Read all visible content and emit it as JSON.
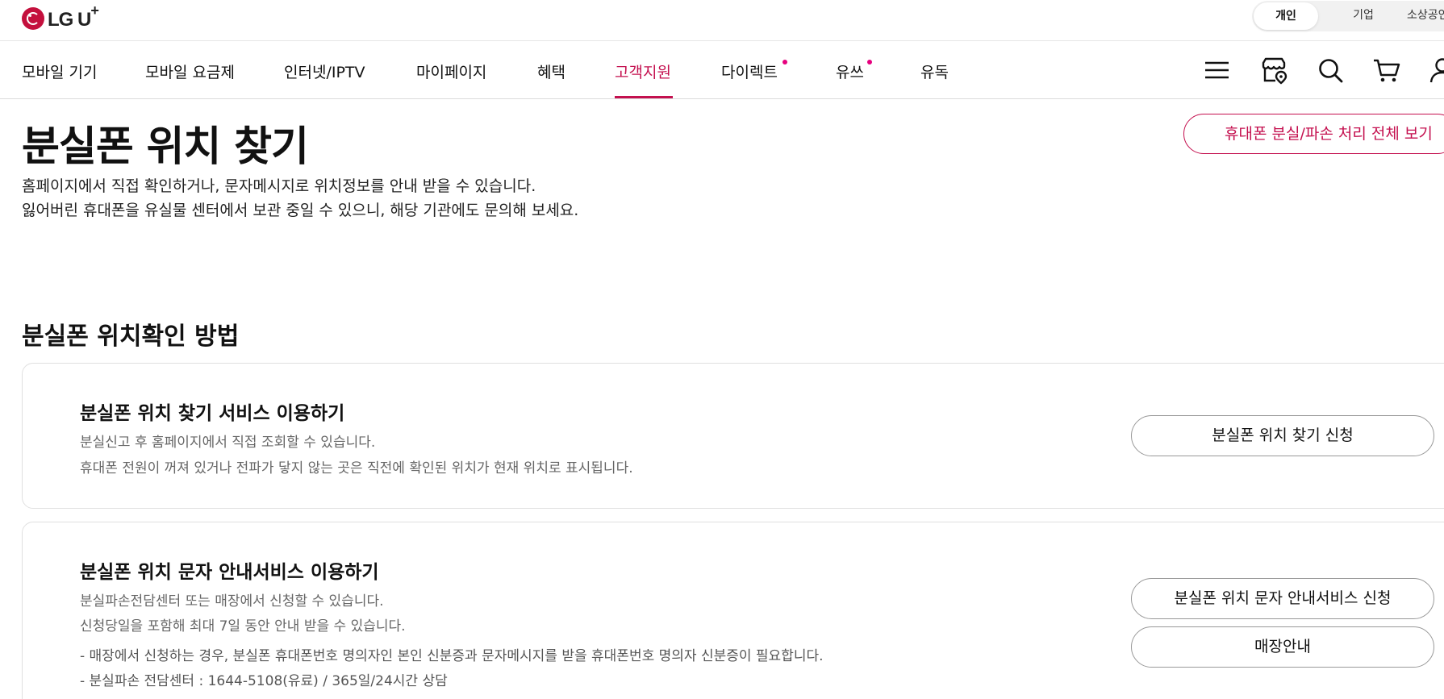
{
  "brand": {
    "logo_text": "LG U",
    "logo_sup": "+"
  },
  "segments": [
    {
      "label": "개인",
      "active": true
    },
    {
      "label": "기업",
      "active": false
    },
    {
      "label": "소상공인",
      "active": false
    }
  ],
  "nav": {
    "items": [
      {
        "label": "모바일 기기"
      },
      {
        "label": "모바일 요금제"
      },
      {
        "label": "인터넷/IPTV"
      },
      {
        "label": "마이페이지"
      },
      {
        "label": "혜택"
      },
      {
        "label": "고객지원",
        "active": true
      },
      {
        "label": "다이렉트",
        "new_dot": true
      },
      {
        "label": "유쓰",
        "new_dot": true
      },
      {
        "label": "유독"
      }
    ],
    "icons": [
      "menu-icon",
      "store-icon",
      "search-icon",
      "cart-icon",
      "user-icon"
    ],
    "accent_color": "#c4104f"
  },
  "header": {
    "title": "분실폰 위치 찾기",
    "desc_line1": "홈페이지에서 직접 확인하거나, 문자메시지로 위치정보를 안내 받을 수 있습니다.",
    "desc_line2": "잃어버린 휴대폰을 유실물 센터에서 보관 중일 수 있으니, 해당 기관에도 문의해 보세요.",
    "all_button": "휴대폰 분실/파손 처리 전체 보기"
  },
  "section": {
    "title": "분실폰 위치확인 방법",
    "cards": [
      {
        "title": "분실폰 위치 찾기 서비스 이용하기",
        "lines": [
          "분실신고 후 홈페이지에서 직접 조회할 수 있습니다.",
          "휴대폰 전원이 꺼져 있거나 전파가 닿지 않는 곳은 직전에 확인된 위치가 현재 위치로 표시됩니다."
        ],
        "buttons": [
          "분실폰 위치 찾기 신청"
        ]
      },
      {
        "title": "분실폰 위치 문자 안내서비스 이용하기",
        "lines": [
          "분실파손전담센터 또는 매장에서 신청할 수 있습니다.",
          "신청당일을 포함해 최대 7일 동안 안내 받을 수 있습니다."
        ],
        "notes": [
          "- 매장에서 신청하는 경우, 분실폰 휴대폰번호 명의자인 본인 신분증과 문자메시지를 받을 휴대폰번호 명의자 신분증이 필요합니다.",
          "- 분실파손 전담센터 : 1644-5108(유료) / 365일/24시간 상담"
        ],
        "buttons": [
          "분실폰 위치 문자 안내서비스 신청",
          "매장안내"
        ]
      }
    ]
  }
}
